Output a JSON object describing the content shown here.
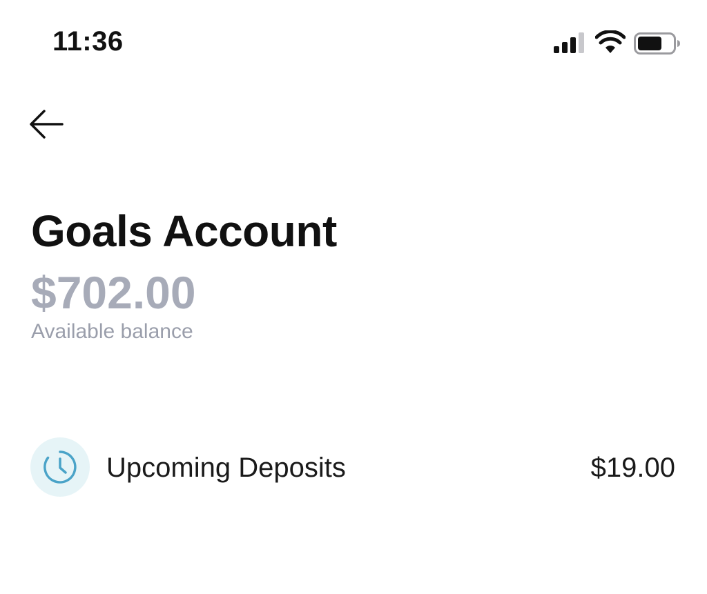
{
  "status_bar": {
    "time": "11:36",
    "icons": [
      "cellular-signal-icon",
      "wifi-icon",
      "battery-icon"
    ]
  },
  "header": {
    "back_icon": "arrow-left-icon"
  },
  "account": {
    "title": "Goals Account",
    "balance": "$702.00",
    "balance_caption": "Available balance"
  },
  "upcoming_deposits": {
    "icon": "clock-icon",
    "label": "Upcoming Deposits",
    "amount": "$19.00"
  },
  "colors": {
    "balance_text": "#a7abb8",
    "caption_text": "#9a9eab",
    "icon_accent": "#4aa3c8",
    "icon_badge_bg": "#e6f4f7"
  }
}
